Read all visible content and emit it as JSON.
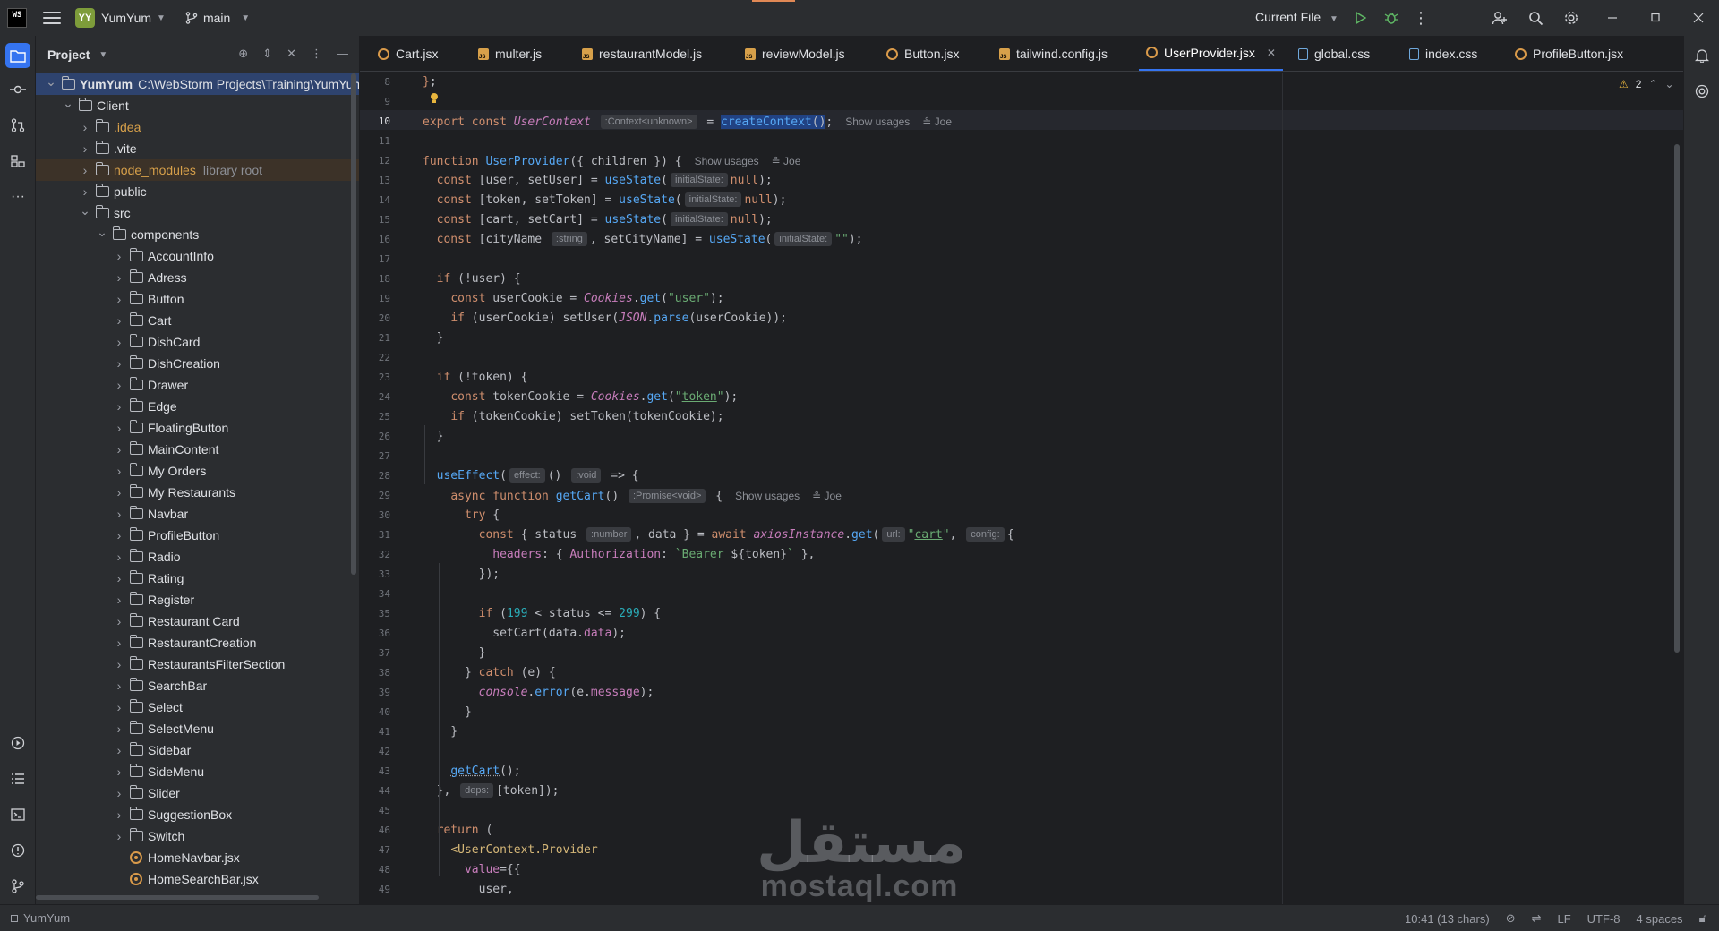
{
  "topbar": {
    "logo": "WS",
    "project_badge": "YY",
    "project_name": "YumYum",
    "branch": "main",
    "run_config": "Current File"
  },
  "project_panel": {
    "title": "Project",
    "tree": [
      {
        "name": "YumYum",
        "extra": "C:\\WebStorm Projects\\Training\\YumYum",
        "type": "folder",
        "depth": 0,
        "open": true,
        "selected": true
      },
      {
        "name": "Client",
        "type": "folder",
        "depth": 1,
        "open": true
      },
      {
        "name": ".idea",
        "type": "folder",
        "depth": 2,
        "open": false,
        "orange": true
      },
      {
        "name": ".vite",
        "type": "folder",
        "depth": 2,
        "open": false
      },
      {
        "name": "node_modules",
        "extra": "library root",
        "type": "folder",
        "depth": 2,
        "open": false,
        "orange": true,
        "libroot": true
      },
      {
        "name": "public",
        "type": "folder",
        "depth": 2,
        "open": false
      },
      {
        "name": "src",
        "type": "folder",
        "depth": 2,
        "open": true
      },
      {
        "name": "components",
        "type": "folder",
        "depth": 3,
        "open": true
      },
      {
        "name": "AccountInfo",
        "type": "folder",
        "depth": 4,
        "open": false
      },
      {
        "name": "Adress",
        "type": "folder",
        "depth": 4,
        "open": false
      },
      {
        "name": "Button",
        "type": "folder",
        "depth": 4,
        "open": false
      },
      {
        "name": "Cart",
        "type": "folder",
        "depth": 4,
        "open": false
      },
      {
        "name": "DishCard",
        "type": "folder",
        "depth": 4,
        "open": false
      },
      {
        "name": "DishCreation",
        "type": "folder",
        "depth": 4,
        "open": false
      },
      {
        "name": "Drawer",
        "type": "folder",
        "depth": 4,
        "open": false
      },
      {
        "name": "Edge",
        "type": "folder",
        "depth": 4,
        "open": false
      },
      {
        "name": "FloatingButton",
        "type": "folder",
        "depth": 4,
        "open": false
      },
      {
        "name": "MainContent",
        "type": "folder",
        "depth": 4,
        "open": false
      },
      {
        "name": "My Orders",
        "type": "folder",
        "depth": 4,
        "open": false
      },
      {
        "name": "My Restaurants",
        "type": "folder",
        "depth": 4,
        "open": false
      },
      {
        "name": "Navbar",
        "type": "folder",
        "depth": 4,
        "open": false
      },
      {
        "name": "ProfileButton",
        "type": "folder",
        "depth": 4,
        "open": false
      },
      {
        "name": "Radio",
        "type": "folder",
        "depth": 4,
        "open": false
      },
      {
        "name": "Rating",
        "type": "folder",
        "depth": 4,
        "open": false
      },
      {
        "name": "Register",
        "type": "folder",
        "depth": 4,
        "open": false
      },
      {
        "name": "Restaurant Card",
        "type": "folder",
        "depth": 4,
        "open": false
      },
      {
        "name": "RestaurantCreation",
        "type": "folder",
        "depth": 4,
        "open": false
      },
      {
        "name": "RestaurantsFilterSection",
        "type": "folder",
        "depth": 4,
        "open": false
      },
      {
        "name": "SearchBar",
        "type": "folder",
        "depth": 4,
        "open": false
      },
      {
        "name": "Select",
        "type": "folder",
        "depth": 4,
        "open": false
      },
      {
        "name": "SelectMenu",
        "type": "folder",
        "depth": 4,
        "open": false
      },
      {
        "name": "Sidebar",
        "type": "folder",
        "depth": 4,
        "open": false
      },
      {
        "name": "SideMenu",
        "type": "folder",
        "depth": 4,
        "open": false
      },
      {
        "name": "Slider",
        "type": "folder",
        "depth": 4,
        "open": false
      },
      {
        "name": "SuggestionBox",
        "type": "folder",
        "depth": 4,
        "open": false
      },
      {
        "name": "Switch",
        "type": "folder",
        "depth": 4,
        "open": false
      },
      {
        "name": "HomeNavbar.jsx",
        "type": "file",
        "depth": 4
      },
      {
        "name": "HomeSearchBar.jsx",
        "type": "file",
        "depth": 4
      }
    ]
  },
  "tabs": [
    {
      "label": "Cart.jsx",
      "icon": "react"
    },
    {
      "label": "multer.js",
      "icon": "js"
    },
    {
      "label": "restaurantModel.js",
      "icon": "js"
    },
    {
      "label": "reviewModel.js",
      "icon": "js"
    },
    {
      "label": "Button.jsx",
      "icon": "react"
    },
    {
      "label": "tailwind.config.js",
      "icon": "js"
    },
    {
      "label": "UserProvider.jsx",
      "icon": "react",
      "active": true
    },
    {
      "label": "global.css",
      "icon": "css"
    },
    {
      "label": "index.css",
      "icon": "css"
    },
    {
      "label": "ProfileButton.jsx",
      "icon": "react"
    }
  ],
  "editor": {
    "warnings": "2",
    "line_numbers": [
      "8",
      "9",
      "10",
      "11",
      "12",
      "13",
      "14",
      "15",
      "16",
      "17",
      "18",
      "19",
      "20",
      "21",
      "22",
      "23",
      "24",
      "25",
      "26",
      "27",
      "28",
      "29",
      "30",
      "31",
      "32",
      "33",
      "34",
      "35",
      "36",
      "37",
      "38",
      "39",
      "40",
      "41",
      "42",
      "43",
      "44",
      "45",
      "46",
      "47",
      "48",
      "49"
    ],
    "current_line": "10",
    "code": [
      "<span class=\"kw\">}</span>;",
      "",
      "<span class=\"kw\">export const</span> <span class=\"cls\">UserContext</span> <span class=\"hint\">:Context&lt;unknown&gt;</span> = <span class=\"fn sel\">createContext</span><span class=\"sel\">()</span>;<span class=\"inlay\">Show usages</span><span class=\"inlay\">≗ Joe</span>",
      "",
      "<span class=\"kw\">function</span> <span class=\"fn\">UserProvider</span>({ children }) {<span class=\"inlay\">Show usages</span><span class=\"inlay\">≗ Joe</span>",
      "  <span class=\"kw\">const</span> [user, setUser] = <span class=\"fn\">useState</span>(<span class=\"hint\">initialState:</span><span class=\"kw\">null</span>);",
      "  <span class=\"kw\">const</span> [token, setToken] = <span class=\"fn\">useState</span>(<span class=\"hint\">initialState:</span><span class=\"kw\">null</span>);",
      "  <span class=\"kw\">const</span> [cart, setCart] = <span class=\"fn\">useState</span>(<span class=\"hint\">initialState:</span><span class=\"kw\">null</span>);",
      "  <span class=\"kw\">const</span> [cityName <span class=\"hint\">:string</span>, setCityName] = <span class=\"fn\">useState</span>(<span class=\"hint\">initialState:</span><span class=\"str\">\"\"</span>);",
      "",
      "  <span class=\"kw\">if</span> (!user) {",
      "    <span class=\"kw\">const</span> userCookie = <span class=\"cls\">Cookies</span>.<span class=\"fn\">get</span>(<span class=\"str\">\"<span class=\"u\">user</span>\"</span>);",
      "    <span class=\"kw\">if</span> (userCookie) setUser(<span class=\"cls\">JSON</span>.<span class=\"fn\">parse</span>(userCookie));",
      "  }",
      "",
      "  <span class=\"kw\">if</span> (!token) {",
      "    <span class=\"kw\">const</span> tokenCookie = <span class=\"cls\">Cookies</span>.<span class=\"fn\">get</span>(<span class=\"str\">\"<span class=\"u\">token</span>\"</span>);",
      "    <span class=\"kw\">if</span> (tokenCookie) setToken(tokenCookie);",
      "  }",
      "",
      "  <span class=\"fn\">useEffect</span>(<span class=\"hint\">effect:</span>() <span class=\"hint\">:void</span> =&gt; {",
      "    <span class=\"kw\">async function</span> <span class=\"fn\">getCart</span>() <span class=\"hint\">:Promise&lt;void&gt;</span> {<span class=\"inlay\">Show usages</span><span class=\"inlay\">≗ Joe</span>",
      "      <span class=\"kw\">try</span> {",
      "        <span class=\"kw\">const</span> { status <span class=\"hint\">:number</span>, data } = <span class=\"kw\">await</span> <span class=\"cls\">axiosInstance</span>.<span class=\"fn\">get</span>(<span class=\"hint\">url:</span><span class=\"str\">\"<span class=\"u\">cart</span>\"</span>, <span class=\"hint\">config:</span>{",
      "          <span class=\"prop\">headers</span>: { <span class=\"prop\">Authorization</span>: <span class=\"str\">`Bearer </span>${token}<span class=\"str\">`</span> },",
      "        });",
      "",
      "        <span class=\"kw\">if</span> (<span class=\"num\">199</span> &lt; status &lt;= <span class=\"num\">299</span>) {",
      "          setCart(data.<span class=\"prop\">data</span>);",
      "        }",
      "      } <span class=\"kw\">catch</span> (e) {",
      "        <span class=\"cls\">console</span>.<span class=\"fn\">error</span>(e.<span class=\"prop\">message</span>);",
      "      }",
      "    }",
      "",
      "    <span class=\"fn\" style=\"text-decoration:underline dotted #9da0a8\">getCart</span>();",
      "  }, <span class=\"hint\">deps:</span>[token]);",
      "",
      "  <span class=\"kw\">return</span> (",
      "    <span class=\"tag\">&lt;UserContext.Provider</span>",
      "      <span class=\"prop\">value</span>={{",
      "        user,"
    ]
  },
  "watermark": {
    "arabic": "مستقل",
    "latin": "mostaql.com"
  },
  "statusbar": {
    "project": "YumYum",
    "position": "10:41 (13 chars)",
    "line_sep": "LF",
    "encoding": "UTF-8",
    "indent": "4 spaces"
  }
}
